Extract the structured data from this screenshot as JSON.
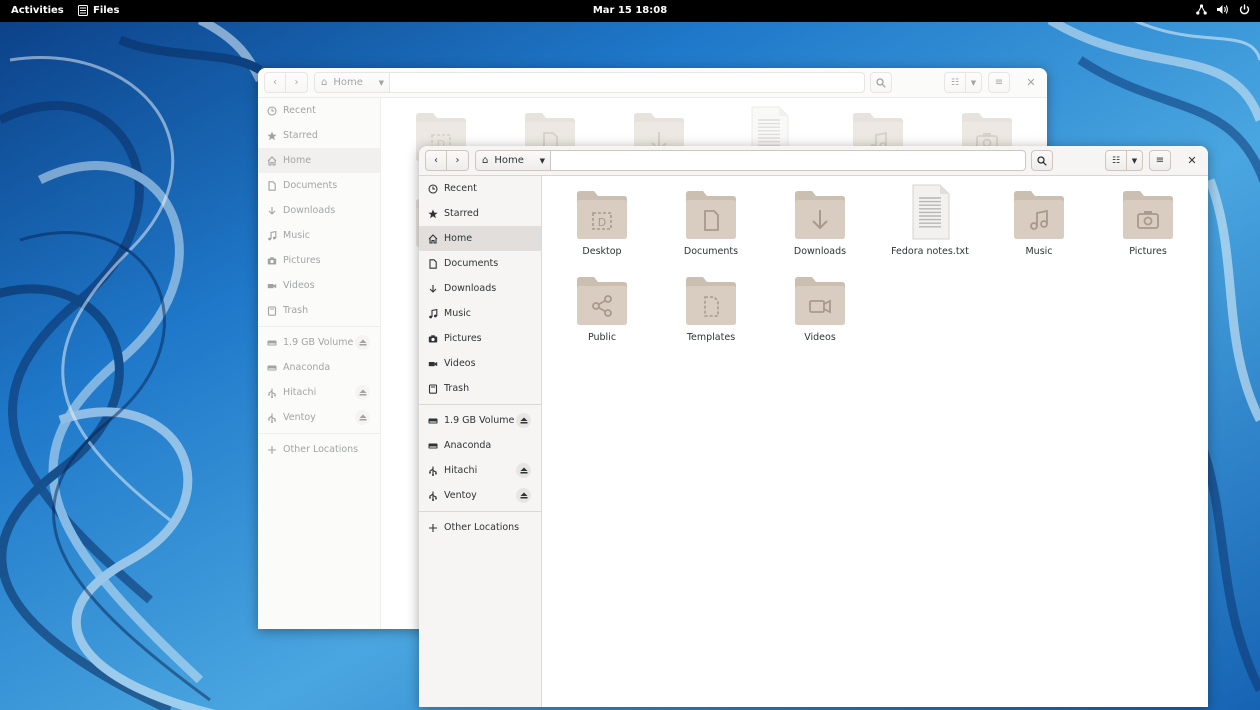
{
  "topbar": {
    "activities": "Activities",
    "app_name": "Files",
    "clock": "Mar 15  18:08"
  },
  "window": {
    "path_home": "Home",
    "sidebar": [
      {
        "label": "Recent",
        "icon": "clock-icon"
      },
      {
        "label": "Starred",
        "icon": "star-icon"
      },
      {
        "label": "Home",
        "icon": "home-icon",
        "active": true
      },
      {
        "label": "Documents",
        "icon": "document-icon"
      },
      {
        "label": "Downloads",
        "icon": "download-icon"
      },
      {
        "label": "Music",
        "icon": "music-icon"
      },
      {
        "label": "Pictures",
        "icon": "camera-icon"
      },
      {
        "label": "Videos",
        "icon": "video-icon"
      },
      {
        "label": "Trash",
        "icon": "trash-icon"
      }
    ],
    "devices": [
      {
        "label": "1.9 GB Volume",
        "eject": true
      },
      {
        "label": "Anaconda",
        "eject": false
      },
      {
        "label": "Hitachi",
        "eject": true
      },
      {
        "label": "Ventoy",
        "eject": true
      }
    ],
    "other_locations": "Other Locations",
    "files": [
      {
        "label": "Desktop",
        "kind": "folder",
        "emblem": "desktop"
      },
      {
        "label": "Documents",
        "kind": "folder",
        "emblem": "document"
      },
      {
        "label": "Downloads",
        "kind": "folder",
        "emblem": "download"
      },
      {
        "label": "Fedora notes.txt",
        "kind": "text"
      },
      {
        "label": "Music",
        "kind": "folder",
        "emblem": "music"
      },
      {
        "label": "Pictures",
        "kind": "folder",
        "emblem": "camera"
      },
      {
        "label": "Public",
        "kind": "folder",
        "emblem": "share"
      },
      {
        "label": "Templates",
        "kind": "folder",
        "emblem": "template"
      },
      {
        "label": "Videos",
        "kind": "folder",
        "emblem": "video"
      }
    ]
  },
  "colors": {
    "folder": "#d8cdc0",
    "folder_tab": "#cbbfb1",
    "folder_emblem": "#a89a8b",
    "headerbar": "#f6f5f4",
    "sidebar_active": "#e1dedb"
  }
}
